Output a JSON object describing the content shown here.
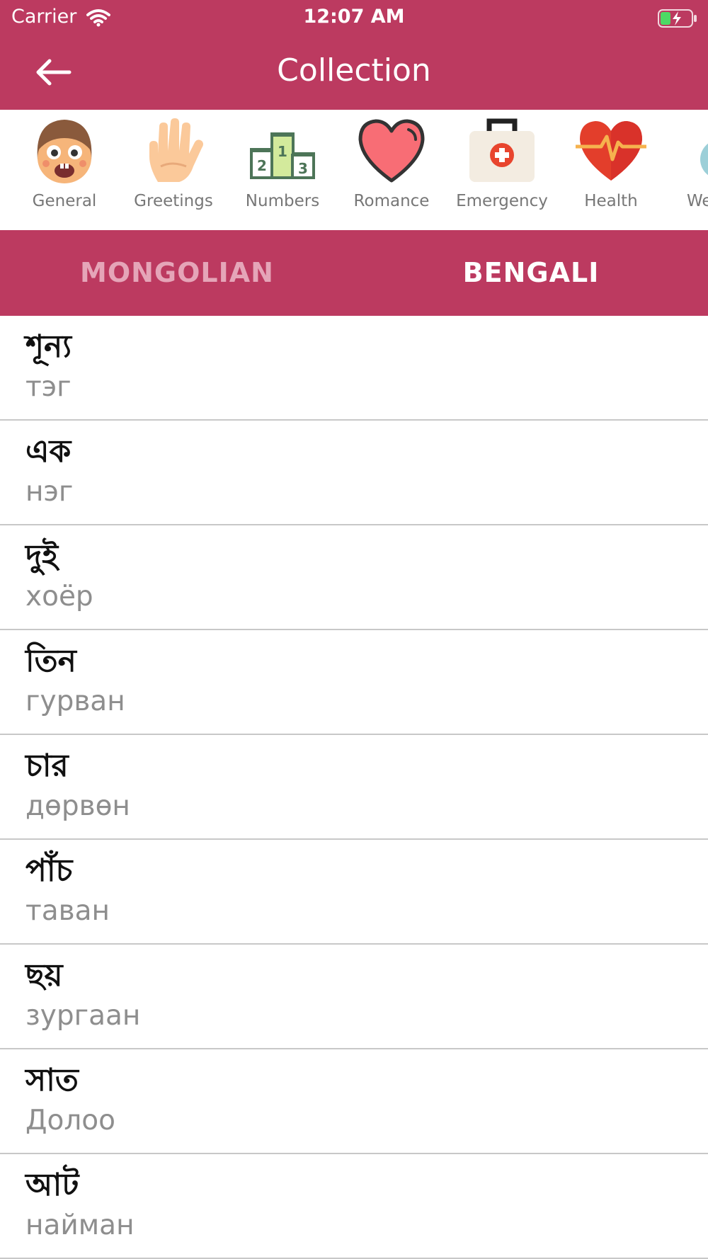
{
  "status_bar": {
    "carrier": "Carrier",
    "time": "12:07 AM",
    "wifi_icon": "wifi-icon",
    "battery_icon": "battery-charging-icon"
  },
  "nav_bar": {
    "title": "Collection",
    "back_icon": "arrow-left-icon"
  },
  "categories": [
    {
      "label": "General",
      "icon": "kid-face-icon"
    },
    {
      "label": "Greetings",
      "icon": "hand-wave-icon"
    },
    {
      "label": "Numbers",
      "icon": "podium-icon"
    },
    {
      "label": "Romance",
      "icon": "heart-icon"
    },
    {
      "label": "Emergency",
      "icon": "first-aid-kit-icon"
    },
    {
      "label": "Health",
      "icon": "heartbeat-icon"
    },
    {
      "label": "We",
      "icon": "weather-icon"
    }
  ],
  "tabs": [
    {
      "label": "MONGOLIAN",
      "selected": false
    },
    {
      "label": "BENGALI",
      "selected": true
    }
  ],
  "words": [
    {
      "bengali": "শূন্য",
      "mongolian": "тэг"
    },
    {
      "bengali": "এক",
      "mongolian": "нэг"
    },
    {
      "bengali": "দুই",
      "mongolian": "хоёр"
    },
    {
      "bengali": "তিন",
      "mongolian": "гурван"
    },
    {
      "bengali": "চার",
      "mongolian": "дөрвөн"
    },
    {
      "bengali": "পাঁচ",
      "mongolian": "таван"
    },
    {
      "bengali": "ছয়",
      "mongolian": "зургаан"
    },
    {
      "bengali": "সাত",
      "mongolian": "Долоо"
    },
    {
      "bengali": "আট",
      "mongolian": "найман"
    }
  ],
  "colors": {
    "brand": "#bc3a60",
    "tab_inactive": "#e5a5b8",
    "secondary_text": "#8e8e8e"
  }
}
